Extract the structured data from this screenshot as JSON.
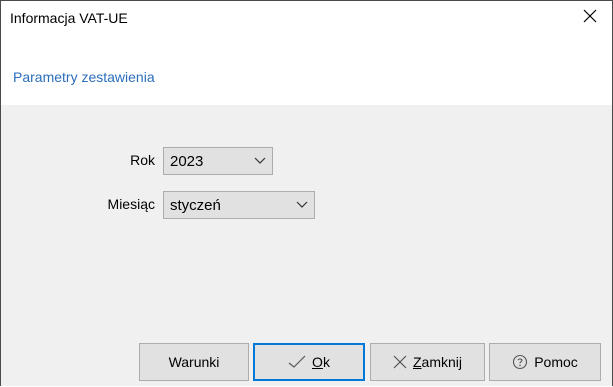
{
  "window": {
    "title": "Informacja VAT-UE",
    "close_icon": "close-icon"
  },
  "section": {
    "title": "Parametry zestawienia"
  },
  "form": {
    "year": {
      "label": "Rok",
      "value": "2023"
    },
    "month": {
      "label": "Miesiąc",
      "value": "styczeń"
    }
  },
  "buttons": {
    "conditions": {
      "label": "Warunki"
    },
    "ok": {
      "mnemonic": "O",
      "rest": "k",
      "icon": "check-icon"
    },
    "close": {
      "mnemonic": "Z",
      "rest": "amknij",
      "icon": "x-icon"
    },
    "help": {
      "label": "Pomoc",
      "icon": "help-circle-icon"
    }
  },
  "colors": {
    "accent": "#0078d7",
    "section_title": "#2a6ebb",
    "client_background": "#f0f0f0",
    "button_face": "#e1e1e1"
  }
}
